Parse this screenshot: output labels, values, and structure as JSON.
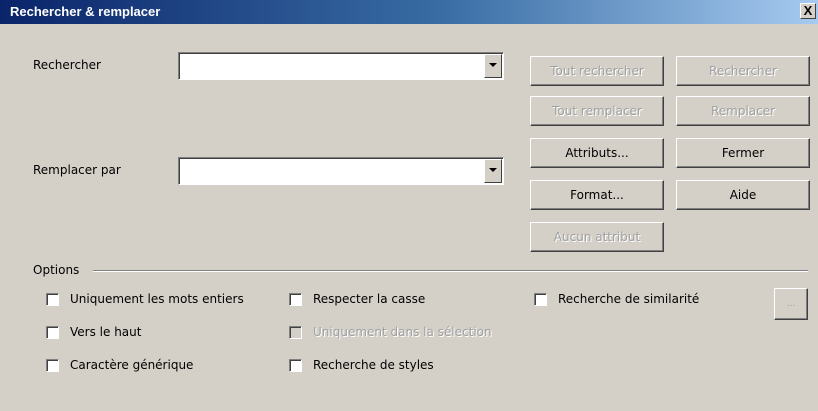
{
  "window": {
    "title": "Rechercher & remplacer",
    "close_label": "X"
  },
  "search": {
    "label": "Rechercher",
    "value": ""
  },
  "replace": {
    "label": "Remplacer par",
    "value": ""
  },
  "buttons": {
    "find_all": "Tout rechercher",
    "find": "Rechercher",
    "replace_all": "Tout remplacer",
    "replace": "Remplacer",
    "attributes": "Attributs...",
    "close": "Fermer",
    "format": "Format...",
    "help": "Aide",
    "no_attribute": "Aucun attribut",
    "similarity_settings": "..."
  },
  "options": {
    "label": "Options",
    "whole_words": "Uniquement les mots entiers",
    "backwards": "Vers le haut",
    "wildcards": "Caractère générique",
    "match_case": "Respecter la casse",
    "selection_only": "Uniquement dans la sélection",
    "search_styles": "Recherche de styles",
    "similarity": "Recherche de similarité"
  },
  "colors": {
    "face": "#d4d0c8",
    "title_start": "#0a246a",
    "title_end": "#a6caf0",
    "disabled_text": "#a0a0a0"
  }
}
